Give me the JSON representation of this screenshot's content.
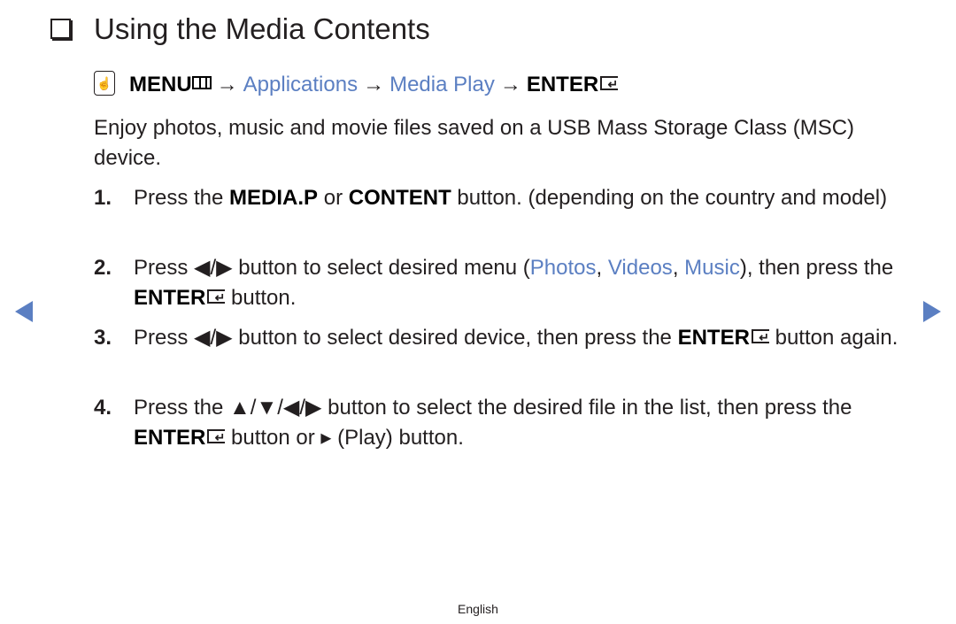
{
  "title": "Using the Media Contents",
  "menu_path": {
    "menu_label": "MENU",
    "arrow": "→",
    "applications": "Applications",
    "media_play": "Media Play",
    "enter_label": "ENTER",
    "hand_icon": "☝"
  },
  "intro": "Enjoy photos, music and movie files saved on a USB Mass Storage Class (MSC) device.",
  "steps": [
    {
      "num": "1.",
      "parts": {
        "a": "Press the ",
        "b1": "MEDIA.P",
        "c": " or ",
        "b2": "CONTENT",
        "d": " button. (depending on the country and model)"
      }
    },
    {
      "num": "2.",
      "parts": {
        "a": "Press ◀/▶ button to select desired menu (",
        "photos": "Photos",
        "sep1": ", ",
        "videos": "Videos",
        "sep2": ", ",
        "music": "Music",
        "b": "), then press the ",
        "enter": "ENTER",
        "c": " button."
      }
    },
    {
      "num": "3.",
      "parts": {
        "a": "Press ◀/▶ button to select desired device, then press the ",
        "enter": "ENTER",
        "c": " button again."
      }
    },
    {
      "num": "4.",
      "parts": {
        "a": "Press the ▲/▼/◀/▶ button to select the desired file in the list, then press the ",
        "enter": "ENTER",
        "c": " button or ▸ (Play) button."
      }
    }
  ],
  "footer": "English",
  "colors": {
    "accent": "#5b7fc2",
    "text": "#231f20"
  }
}
